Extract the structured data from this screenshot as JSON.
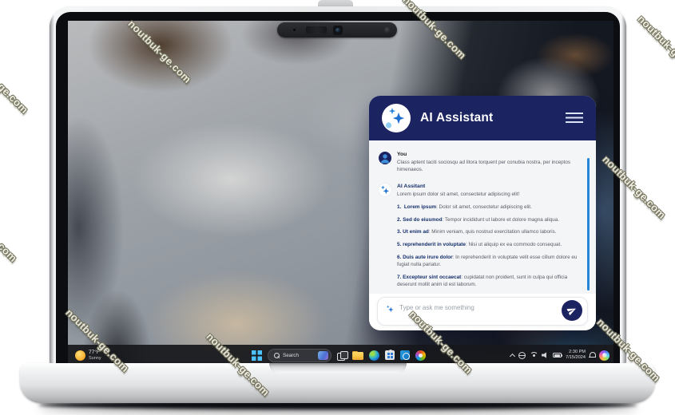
{
  "watermark": {
    "text": "noutbuk-ge.com"
  },
  "assistant_panel": {
    "title": "AI Assistant",
    "messages": {
      "user": {
        "sender": "You",
        "text": "Class aptent taciti sociosqu ad litora torquent per conubia nostra, per inceptos himenaeos."
      },
      "assistant": {
        "sender": "AI Assitant",
        "intro": "Lorem ipsum dolor sit amet, consectetur adipiscing elit!",
        "list": [
          {
            "num": "1.",
            "term": "Lorem ipsum",
            "text": ": Dolor sit amet, consectetur adipiscing elit."
          },
          {
            "num": "2.",
            "term": "Sed do eiusmod",
            "text": ": Tempor incididunt ut labore et dolore magna aliqua."
          },
          {
            "num": "3.",
            "term": "Ut enim ad",
            "text": ": Minim veniam, quis nostrud exercitation ullamco laboris."
          },
          {
            "num": "5.",
            "term": "reprehenderit in voluptate",
            "text": ": Nisi ut aliquip ex ea commodo consequat."
          },
          {
            "num": "6.",
            "term": "Duis aute irure dolor",
            "text": ": In reprehenderit in voluptate velit esse cillum dolore eu fugiat nulla pariatur."
          },
          {
            "num": "7.",
            "term": "Excepteur sint occaecat",
            "text": ": cupidatat non proident, sunt in culpa qui officia deserunt mollit anim id est laborum."
          }
        ]
      }
    },
    "input": {
      "placeholder": "Type or ask me something"
    }
  },
  "taskbar": {
    "weather": {
      "temp": "77°F",
      "condition": "Sunny"
    },
    "search_label": "Search",
    "clock": {
      "time": "2:30 PM",
      "date": "7/15/2024"
    }
  },
  "colors": {
    "panel_navy": "#1b2361",
    "scrollbar_blue": "#2585d6",
    "sparkle_blue": "#2f86d8",
    "taskbar_dark": "#191a1d",
    "folder_yellow": "#f7c64a"
  },
  "icons": {
    "logo": "ai-sparkles",
    "menu": "hamburger",
    "send": "paper-plane",
    "user": "person",
    "search": "magnifier",
    "start": "windows-logo",
    "tray": [
      "chevron-up",
      "globe",
      "wifi",
      "speaker",
      "battery",
      "bell",
      "copilot"
    ]
  }
}
